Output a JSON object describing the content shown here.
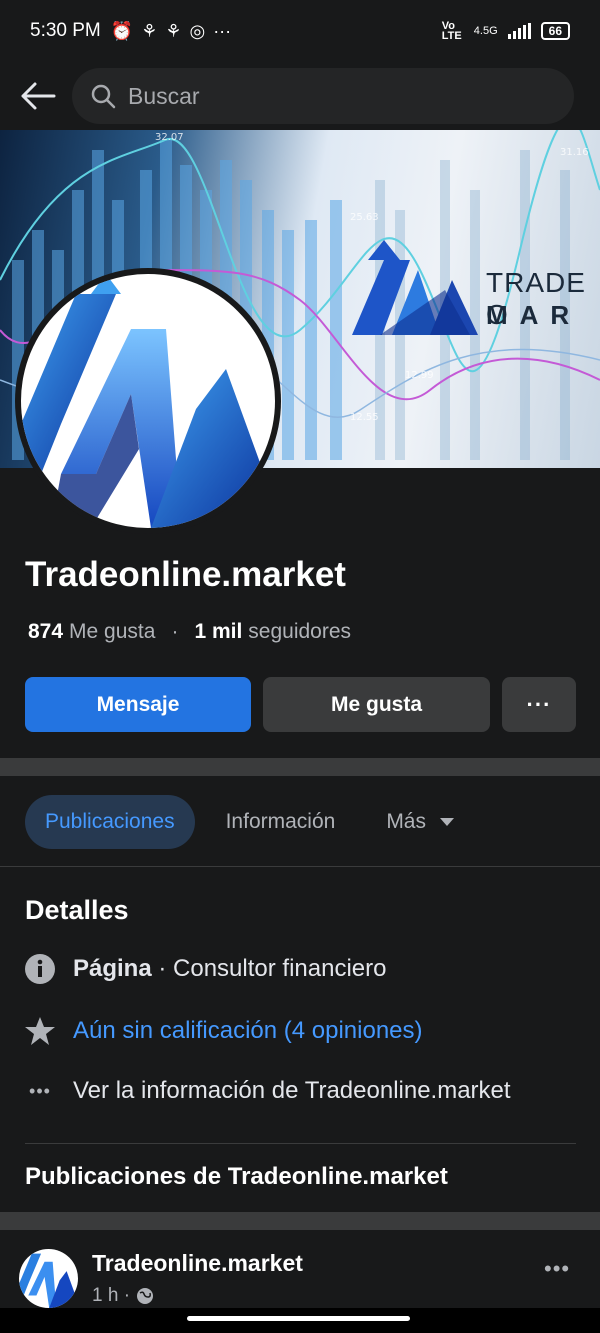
{
  "status_bar": {
    "time": "5:30 PM",
    "network": "4.5G",
    "lte": "Vo LTE",
    "battery": "66"
  },
  "search": {
    "placeholder": "Buscar"
  },
  "cover": {
    "brand_line1": "TRADE O",
    "brand_line2": "MAR",
    "chart_labels": [
      "32.07",
      "25.63",
      "12.99",
      "12.55",
      "31.16"
    ]
  },
  "page": {
    "name": "Tradeonline.market",
    "likes_count": "874",
    "likes_label": "Me gusta",
    "followers_count": "1 mil",
    "followers_label": "seguidores"
  },
  "actions": {
    "message": "Mensaje",
    "like": "Me gusta",
    "more": "···"
  },
  "tabs": [
    {
      "label": "Publicaciones",
      "active": true
    },
    {
      "label": "Información",
      "active": false
    },
    {
      "label": "Más",
      "active": false
    }
  ],
  "details": {
    "title": "Detalles",
    "category_bold": "Página",
    "category_rest": " · Consultor financiero",
    "rating": "Aún sin calificación (4 opiniones)",
    "see_info": "Ver la información de Tradeonline.market"
  },
  "posts": {
    "title": "Publicaciones de Tradeonline.market",
    "author": "Tradeonline.market",
    "time": "1 h ·",
    "more": "•••"
  },
  "colors": {
    "background": "#18191a",
    "accent": "#2374e1",
    "link": "#4599ff",
    "button_gray": "#3a3b3c"
  }
}
